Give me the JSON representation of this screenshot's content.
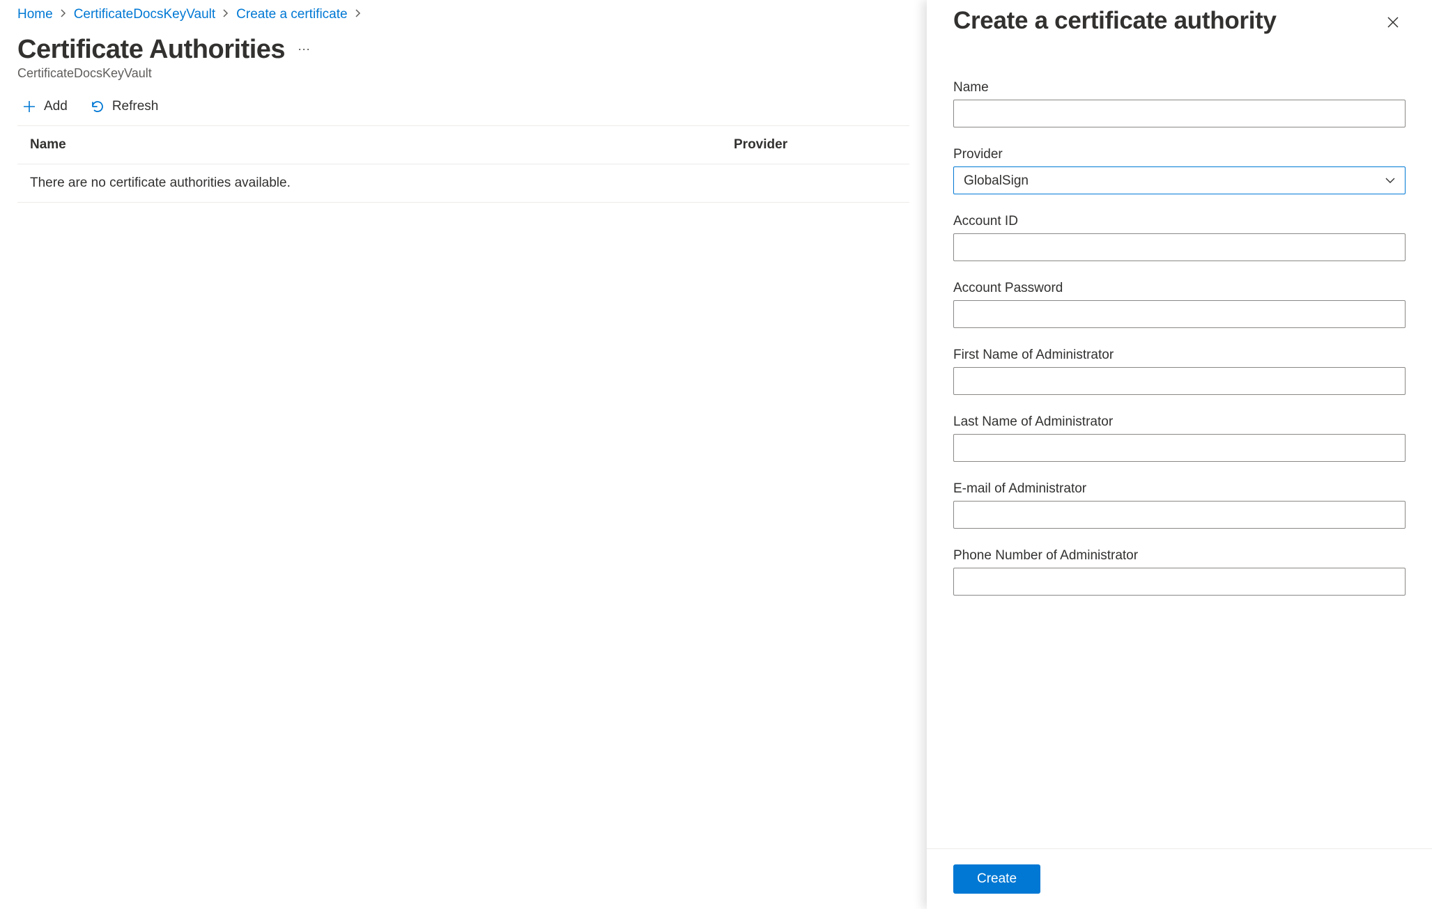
{
  "breadcrumb": {
    "items": [
      "Home",
      "CertificateDocsKeyVault",
      "Create a certificate"
    ]
  },
  "page": {
    "title": "Certificate Authorities",
    "subtitle": "CertificateDocsKeyVault"
  },
  "toolbar": {
    "add_label": "Add",
    "refresh_label": "Refresh"
  },
  "table": {
    "headers": {
      "name": "Name",
      "provider": "Provider"
    },
    "empty_message": "There are no certificate authorities available."
  },
  "panel": {
    "title": "Create a certificate authority",
    "fields": {
      "name": {
        "label": "Name",
        "value": ""
      },
      "provider": {
        "label": "Provider",
        "value": "GlobalSign"
      },
      "account_id": {
        "label": "Account ID",
        "value": ""
      },
      "account_password": {
        "label": "Account Password",
        "value": ""
      },
      "first_name": {
        "label": "First Name of Administrator",
        "value": ""
      },
      "last_name": {
        "label": "Last Name of Administrator",
        "value": ""
      },
      "email": {
        "label": "E-mail of Administrator",
        "value": ""
      },
      "phone": {
        "label": "Phone Number of Administrator",
        "value": ""
      }
    },
    "create_label": "Create"
  }
}
